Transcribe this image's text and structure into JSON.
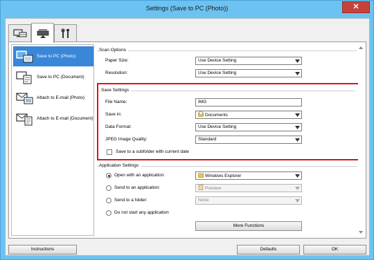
{
  "window": {
    "title": "Settings (Save to PC (Photo))",
    "close_glyph": "✕"
  },
  "tabs": [
    {
      "icon": "scan-from-computer-icon"
    },
    {
      "icon": "scan-from-panel-icon"
    },
    {
      "icon": "general-settings-icon"
    }
  ],
  "sidebar": {
    "items": [
      {
        "label": "Save to PC (Photo)",
        "icon": "save-photo-icon",
        "active": true
      },
      {
        "label": "Save to PC (Document)",
        "icon": "save-document-icon",
        "active": false
      },
      {
        "label": "Attach to E-mail (Photo)",
        "icon": "email-photo-icon",
        "active": false
      },
      {
        "label": "Attach to E-mail (Document)",
        "icon": "email-document-icon",
        "active": false
      }
    ]
  },
  "scan_options": {
    "title": "Scan Options",
    "paper_size_label": "Paper Size:",
    "paper_size_value": "Use Device Setting",
    "resolution_label": "Resolution:",
    "resolution_value": "Use Device Setting"
  },
  "save_settings": {
    "title": "Save Settings",
    "file_name_label": "File Name:",
    "file_name_value": "IMG",
    "save_in_label": "Save in:",
    "save_in_value": "Documents",
    "data_format_label": "Data Format:",
    "data_format_value": "Use Device Setting",
    "jpeg_quality_label": "JPEG Image Quality:",
    "jpeg_quality_value": "Standard",
    "subfolder_label": "Save to a subfolder with current date",
    "subfolder_checked": false,
    "highlight_color": "#d6141a"
  },
  "application_settings": {
    "title": "Application Settings",
    "open_app_label": "Open with an application:",
    "open_app_value": "Windows Explorer",
    "send_app_label": "Send to an application:",
    "send_app_value": "Preview",
    "send_folder_label": "Send to a folder:",
    "send_folder_value": "None",
    "no_app_label": "Do not start any application",
    "more_functions_label": "More Functions",
    "selected": "open_app"
  },
  "footer": {
    "instructions_label": "Instructions",
    "defaults_label": "Defaults",
    "ok_label": "OK"
  },
  "colors": {
    "titlebar": "#6cc3f1",
    "close": "#c7433a",
    "sidebar_active": "#3a86d8"
  }
}
